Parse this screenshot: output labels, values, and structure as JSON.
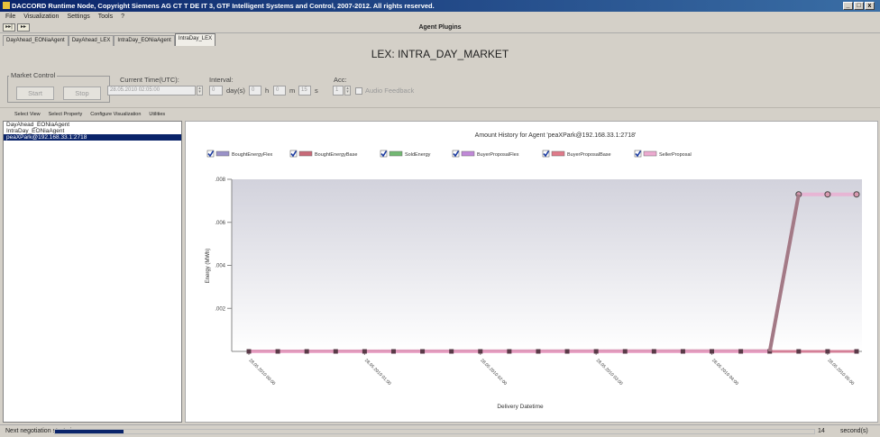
{
  "window": {
    "title": "DACCORD Runtime Node, Copyright Siemens AG CT T DE IT 3, GTF Intelligent Systems and Control, 2007-2012. All rights reserved.",
    "min_label": "_",
    "restore_label": "□",
    "close_label": "x"
  },
  "menu": [
    "File",
    "Visualization",
    "Settings",
    "Tools",
    "?"
  ],
  "toolbar": {
    "play_label": "▸▸|",
    "next_label": "▸▸"
  },
  "plugins_title": "Agent Plugins",
  "tabs": [
    {
      "label": "DayAhead_EONiaAgent",
      "active": false
    },
    {
      "label": "DayAhead_LEX",
      "active": false
    },
    {
      "label": "IntraDay_EONiaAgent",
      "active": false
    },
    {
      "label": "IntraDay_LEX",
      "active": true
    }
  ],
  "market_title": "LEX: INTRA_DAY_MARKET",
  "market_control": {
    "group_label": "Market Control",
    "start_label": "Start",
    "stop_label": "Stop",
    "current_time_label": "Current Time(UTC):",
    "current_time_value": "28.05.2010 02:05:00",
    "interval_label": "Interval:",
    "interval_days": "0",
    "days_unit": "day(s)",
    "interval_hours": "0",
    "hours_unit": "h",
    "interval_minutes": "0",
    "minutes_unit": "m",
    "interval_seconds": "15",
    "seconds_unit": "s",
    "acc_label": "Acc:",
    "acc_value": "1",
    "audio_feedback_label": "Audio Feedback"
  },
  "view_menu": [
    "Select View",
    "Select Property",
    "Configure Visualization",
    "Utilities"
  ],
  "agents": [
    {
      "label": "DayAhead_EONiaAgent",
      "selected": false
    },
    {
      "label": "IntraDay_EONiaAgent",
      "selected": false
    },
    {
      "label": "peaXPark@192.168.33.1:2718",
      "selected": true
    }
  ],
  "chart_data": {
    "type": "line",
    "title": "Amount History for Agent 'peaXPark@192.168.33.1:2718'",
    "xlabel": "Delivery Datetime",
    "ylabel": "Energy (MWh)",
    "ylim": [
      0,
      0.008
    ],
    "yticks": [
      ".008",
      ".006",
      ".004",
      ".002"
    ],
    "x_tick_labels": [
      "28.05.2010 00:00",
      "28.05.2010 01:00",
      "28.05.2010 02:00",
      "28.05.2010 03:00",
      "28.05.2010 04:00",
      "28.05.2010 05:00"
    ],
    "x_tick_index": [
      0,
      4,
      8,
      12,
      16,
      20
    ],
    "point_count": 22,
    "legend_position": "top",
    "series": [
      {
        "name": "BoughtEnergyFlex",
        "color": "#9a92c8",
        "values": [
          0,
          0,
          0,
          0,
          0,
          0,
          0,
          0,
          0,
          0,
          0,
          0,
          0,
          0,
          0,
          0,
          0,
          0,
          0,
          0,
          0,
          0
        ]
      },
      {
        "name": "BoughtEnergyBase",
        "color": "#c86a78",
        "values": [
          0,
          0,
          0,
          0,
          0,
          0,
          0,
          0,
          0,
          0,
          0,
          0,
          0,
          0,
          0,
          0,
          0,
          0,
          0,
          0,
          0,
          0
        ]
      },
      {
        "name": "SoldEnergy",
        "color": "#72b872",
        "values": [
          0,
          0,
          0,
          0,
          0,
          0,
          0,
          0,
          0,
          0,
          0,
          0,
          0,
          0,
          0,
          0,
          0,
          0,
          0,
          0,
          0,
          0
        ]
      },
      {
        "name": "BuyerProposalFlex",
        "color": "#c088d8",
        "values": [
          0,
          0,
          0,
          0,
          0,
          0,
          0,
          0,
          0,
          0,
          0,
          0,
          0,
          0,
          0,
          0,
          0,
          0,
          0,
          0,
          0,
          0
        ]
      },
      {
        "name": "BuyerProposalBase",
        "color": "#e07a8a",
        "values": [
          0,
          0,
          0,
          0,
          0,
          0,
          0,
          0,
          0,
          0,
          0,
          0,
          0,
          0,
          0,
          0,
          0,
          0,
          0,
          0,
          0,
          0
        ]
      },
      {
        "name": "SellerProposal",
        "color": "#ecaad0",
        "values": [
          0,
          0,
          0,
          0,
          0,
          0,
          0,
          0,
          0,
          0,
          0,
          0,
          0,
          0,
          0,
          0,
          0,
          0,
          0,
          0.0073,
          0.0073,
          0.0073
        ]
      }
    ]
  },
  "status": {
    "text": "Next negotiation starts in",
    "progress": 0.09,
    "progress_color": "#0a246a",
    "count": "14",
    "unit": "second(s)"
  }
}
